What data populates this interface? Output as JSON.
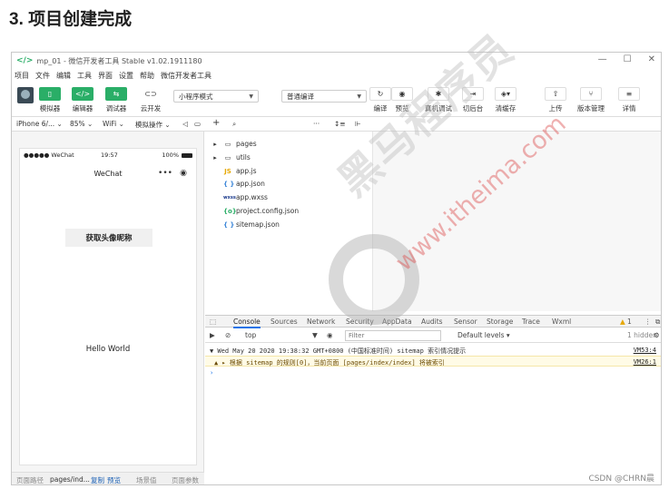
{
  "heading": "3. 项目创建完成",
  "window": {
    "logo": "</>",
    "title": "mp_01 - 微信开发者工具 Stable v1.02.1911180",
    "controls": [
      "—",
      "☐",
      "✕"
    ]
  },
  "menu": [
    "项目",
    "文件",
    "编辑",
    "工具",
    "界面",
    "设置",
    "帮助",
    "微信开发者工具"
  ],
  "toolbar": {
    "simulator": "模拟器",
    "editor": "编辑器",
    "debugger": "调试器",
    "cloud": "云开发",
    "mode_select": "小程序模式",
    "compile_select": "普通编译",
    "compile": "编译",
    "preview": "预览",
    "remote_debug": "真机调试",
    "background": "切后台",
    "clear_cache": "清缓存",
    "upload": "上传",
    "version": "版本管理",
    "details": "详情"
  },
  "subbar": {
    "device": "iPhone 6/...",
    "zoom": "85%",
    "network": "WiFi",
    "sim_ops": "模拟操作"
  },
  "phone": {
    "carrier": "●●●●● WeChat",
    "time": "19:57",
    "battery": "100%",
    "nav_title": "WeChat",
    "avatar_button": "获取头像昵称",
    "hello": "Hello World"
  },
  "sim_footer": {
    "path_label": "页面路径",
    "path": "pages/ind...",
    "copy": "复制",
    "preview": "预览",
    "scene": "场景值",
    "params": "页面参数"
  },
  "files": [
    {
      "name": "pages",
      "icon": "folder",
      "glyph": "▸"
    },
    {
      "name": "utils",
      "icon": "folder",
      "glyph": "▸"
    },
    {
      "name": "app.js",
      "icon": "js",
      "glyph": "JS"
    },
    {
      "name": "app.json",
      "icon": "json",
      "glyph": "{ }"
    },
    {
      "name": "app.wxss",
      "icon": "wxss",
      "glyph": "wxss"
    },
    {
      "name": "project.config.json",
      "icon": "config",
      "glyph": "{o}"
    },
    {
      "name": "sitemap.json",
      "icon": "json",
      "glyph": "{ }"
    }
  ],
  "devtools": {
    "tabs": [
      "Console",
      "Sources",
      "Network",
      "Security",
      "AppData",
      "Audits",
      "Sensor",
      "Storage",
      "Trace",
      "Wxml"
    ],
    "warn_count": "1",
    "context": "top",
    "filter_placeholder": "Filter",
    "levels": "Default levels ▾",
    "hidden": "1 hidden"
  },
  "console": [
    {
      "text": "▼ Wed May 20 2020 19:38:32 GMT+0800 (中国标准时间) sitemap 索引情况提示",
      "source": "VM53:4",
      "level": "info"
    },
    {
      "text": "▲ ▸ 根据 sitemap 的规则[0]，当前页面 [pages/index/index] 将被索引",
      "source": "VM26:1",
      "level": "warn"
    }
  ],
  "watermark": {
    "brand": "黑马程序员",
    "url": "www.itheima.com",
    "csdn": "CSDN @CHRN晨"
  },
  "colors": {
    "accent_green": "#2aae67",
    "devtools_blue": "#1a73e8",
    "warn_bg": "#fffbe6"
  }
}
